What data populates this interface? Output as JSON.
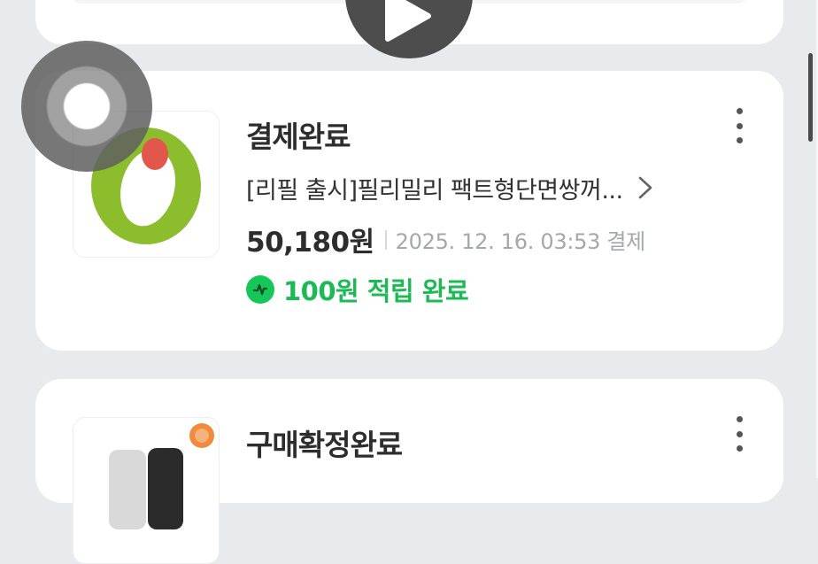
{
  "orders": [
    {
      "status": "결제완료",
      "product_name": "[리필 출시]필리밀리 팩트형단면쌍꺼...",
      "price": "50,180원",
      "date": "2025. 12. 16. 03:53 결제",
      "points": "100원 적립 완료"
    },
    {
      "status": "구매확정완료"
    }
  ],
  "colors": {
    "background": "#e9eaee",
    "card": "#ffffff",
    "points_green": "#1db954",
    "date_gray": "#a4a7ad"
  },
  "icons": [
    "play-icon",
    "more-vertical-icon",
    "chevron-right-icon",
    "naver-pay-points-icon",
    "touch-indicator"
  ]
}
